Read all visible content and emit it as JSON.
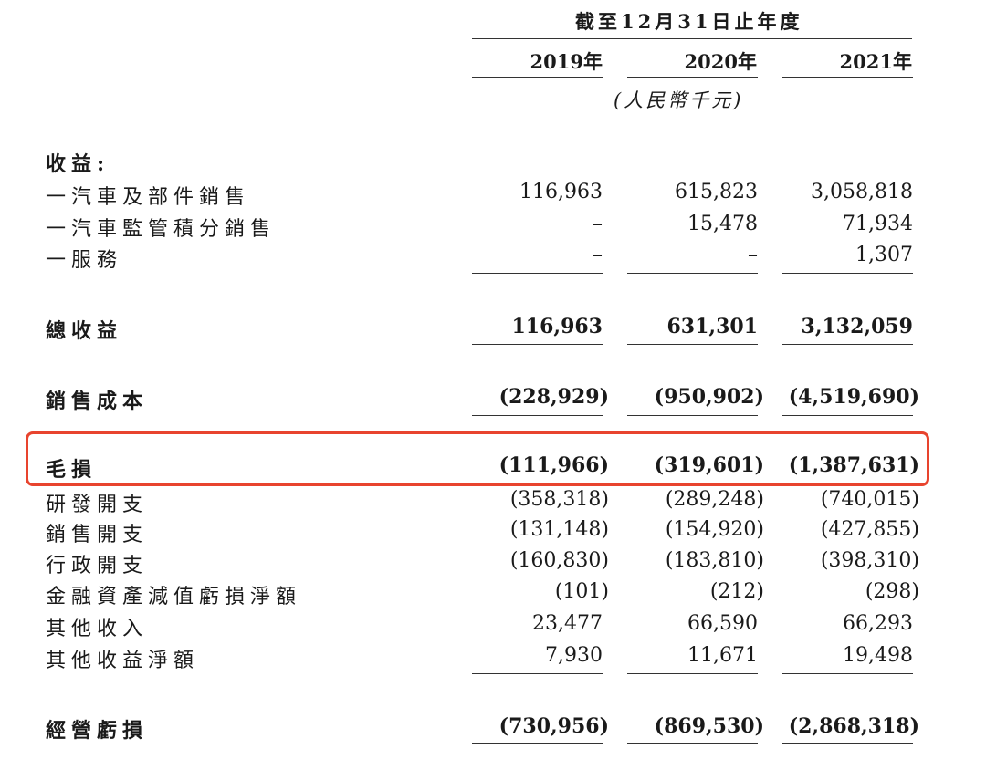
{
  "header": {
    "period": "截至12月31日止年度",
    "years": [
      "2019年",
      "2020年",
      "2021年"
    ],
    "unit": "(人民幣千元)"
  },
  "sections": {
    "revenue_title": "收益:"
  },
  "rows": [
    {
      "label": "一汽車及部件銷售",
      "values": [
        "116,963",
        "615,823",
        "3,058,818"
      ]
    },
    {
      "label": "一汽車監管積分銷售",
      "values": [
        "–",
        "15,478",
        "71,934"
      ]
    },
    {
      "label": "一服務",
      "values": [
        "–",
        "–",
        "1,307"
      ]
    },
    {
      "label": "總收益",
      "values": [
        "116,963",
        "631,301",
        "3,132,059"
      ]
    },
    {
      "label": "銷售成本",
      "values": [
        "(228,929)",
        "(950,902)",
        "(4,519,690)"
      ]
    },
    {
      "label": "毛損",
      "values": [
        "(111,966)",
        "(319,601)",
        "(1,387,631)"
      ]
    },
    {
      "label": "研發開支",
      "values": [
        "(358,318)",
        "(289,248)",
        "(740,015)"
      ]
    },
    {
      "label": "銷售開支",
      "values": [
        "(131,148)",
        "(154,920)",
        "(427,855)"
      ]
    },
    {
      "label": "行政開支",
      "values": [
        "(160,830)",
        "(183,810)",
        "(398,310)"
      ]
    },
    {
      "label": "金融資產減值虧損淨額",
      "values": [
        "(101)",
        "(212)",
        "(298)"
      ]
    },
    {
      "label": "其他收入",
      "values": [
        "23,477",
        "66,590",
        "66,293"
      ]
    },
    {
      "label": "其他收益淨額",
      "values": [
        "7,930",
        "11,671",
        "19,498"
      ]
    },
    {
      "label": "經營虧損",
      "values": [
        "(730,956)",
        "(869,530)",
        "(2,868,318)"
      ]
    }
  ],
  "colors": {
    "highlight": "#e8442e",
    "text": "#1a1a1a"
  }
}
